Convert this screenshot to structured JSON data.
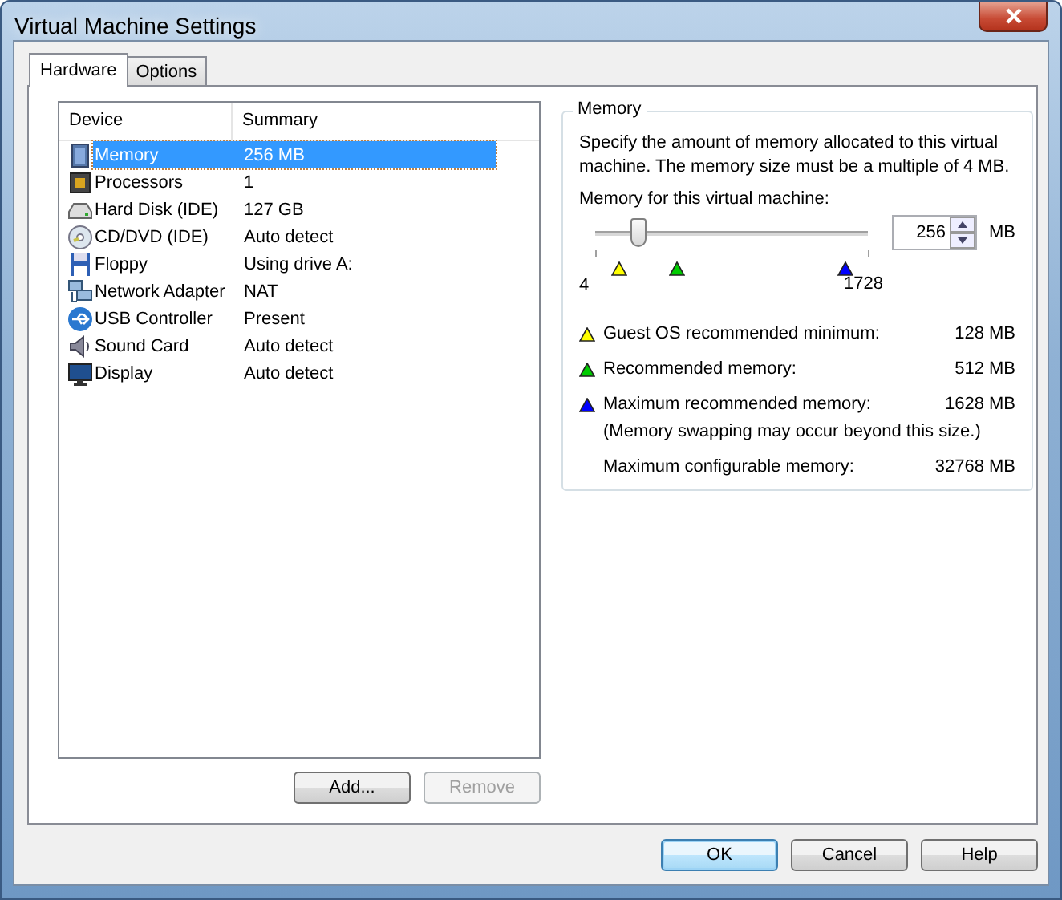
{
  "window": {
    "title": "Virtual Machine Settings"
  },
  "tabs": [
    {
      "label": "Hardware",
      "selected": true
    },
    {
      "label": "Options",
      "selected": false
    }
  ],
  "device_list": {
    "columns": [
      "Device",
      "Summary"
    ],
    "rows": [
      {
        "kind": "memory",
        "device": "Memory",
        "summary": "256 MB",
        "selected": true
      },
      {
        "kind": "processor",
        "device": "Processors",
        "summary": "1",
        "selected": false
      },
      {
        "kind": "disk",
        "device": "Hard Disk (IDE)",
        "summary": "127 GB",
        "selected": false
      },
      {
        "kind": "cd",
        "device": "CD/DVD (IDE)",
        "summary": "Auto detect",
        "selected": false
      },
      {
        "kind": "floppy",
        "device": "Floppy",
        "summary": "Using drive A:",
        "selected": false
      },
      {
        "kind": "network",
        "device": "Network Adapter",
        "summary": "NAT",
        "selected": false
      },
      {
        "kind": "usb",
        "device": "USB Controller",
        "summary": "Present",
        "selected": false
      },
      {
        "kind": "sound",
        "device": "Sound Card",
        "summary": "Auto detect",
        "selected": false
      },
      {
        "kind": "display",
        "device": "Display",
        "summary": "Auto detect",
        "selected": false
      }
    ]
  },
  "list_buttons": [
    {
      "label": "Add...",
      "disabled": false
    },
    {
      "label": "Remove",
      "disabled": true
    }
  ],
  "memory": {
    "title": "Memory",
    "description": "Specify the amount of memory allocated to this virtual machine. The memory size must be a multiple of 4 MB.",
    "slider_label": "Memory for this virtual machine:",
    "slider": {
      "level": 0.16,
      "min_label": "4",
      "max_label": "1728"
    },
    "markers": [
      {
        "color": "#ffff00",
        "level": 0.09
      },
      {
        "color": "#00cc00",
        "level": 0.3
      },
      {
        "color": "#0000ff",
        "level": 0.91
      }
    ],
    "spin_value": "256",
    "unit": "MB",
    "legend": [
      {
        "color": "#ffff00",
        "label": "Guest OS recommended minimum:",
        "value": "128 MB"
      },
      {
        "color": "#00cc00",
        "label": "Recommended memory:",
        "value": "512 MB"
      },
      {
        "color": "#0000ff",
        "label": "Maximum recommended memory:",
        "value": "1628 MB"
      }
    ],
    "note": "(Memory swapping may occur beyond this size.)",
    "max_configurable": {
      "label": "Maximum configurable memory:",
      "value": "32768 MB"
    }
  },
  "buttons": [
    {
      "label": "OK",
      "default": true
    },
    {
      "label": "Cancel",
      "default": false
    },
    {
      "label": "Help",
      "default": false
    }
  ]
}
